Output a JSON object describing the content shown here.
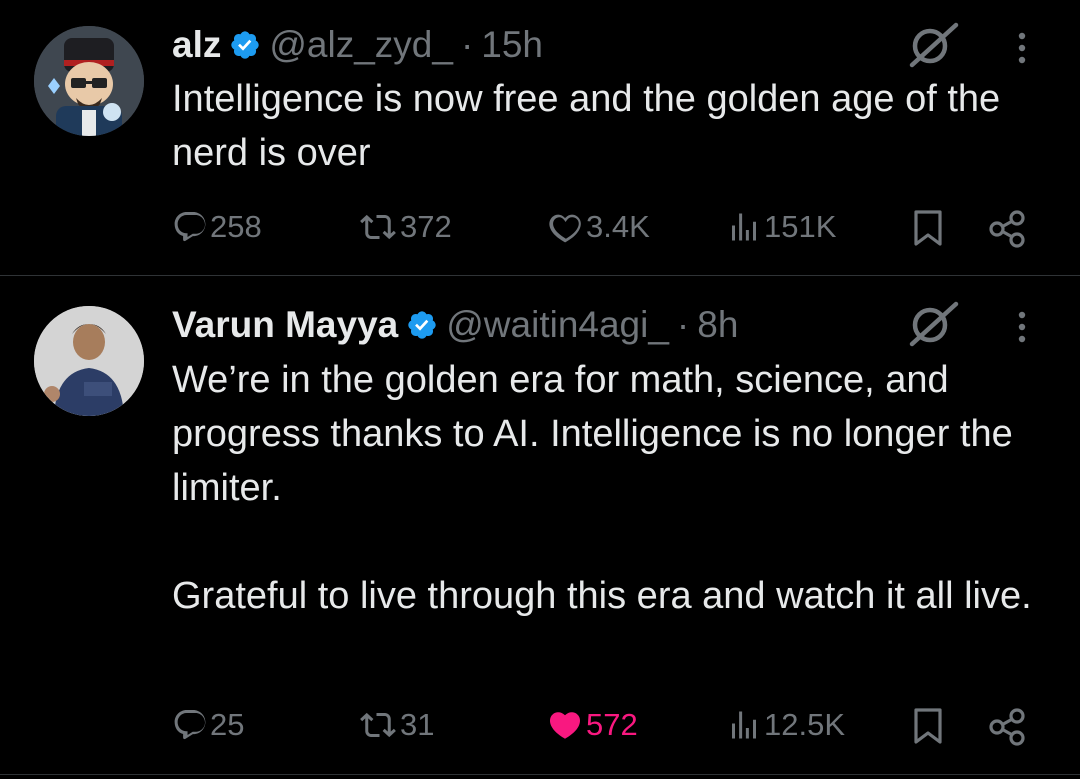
{
  "colors": {
    "background": "#000000",
    "text": "#e7e9ea",
    "muted": "#71767b",
    "verified": "#1d9bf0",
    "like": "#f91880",
    "divider": "#2f3336"
  },
  "tweets": [
    {
      "name": "alz",
      "verified": true,
      "handle": "@alz_zyd_",
      "separator": "·",
      "time": "15h",
      "paragraphs": [
        "Intelligence is now free and the golden age of the nerd is over"
      ],
      "replies": "258",
      "reposts": "372",
      "likes": "3.4K",
      "liked": false,
      "views": "151K",
      "icons": [
        "reply-icon",
        "repost-icon",
        "like-icon",
        "views-icon",
        "bookmark-icon",
        "share-icon",
        "grok-icon",
        "more-icon"
      ]
    },
    {
      "name": "Varun Mayya",
      "verified": true,
      "handle": "@waitin4agi_",
      "separator": "·",
      "time": "8h",
      "paragraphs": [
        "We’re in the golden era for math, science, and progress thanks to AI. Intelligence is no longer the limiter.",
        "Grateful to live through this era and watch it all live."
      ],
      "replies": "25",
      "reposts": "31",
      "likes": "572",
      "liked": true,
      "views": "12.5K",
      "icons": [
        "reply-icon",
        "repost-icon",
        "like-icon-filled",
        "views-icon",
        "bookmark-icon",
        "share-icon",
        "grok-icon",
        "more-icon"
      ]
    }
  ]
}
